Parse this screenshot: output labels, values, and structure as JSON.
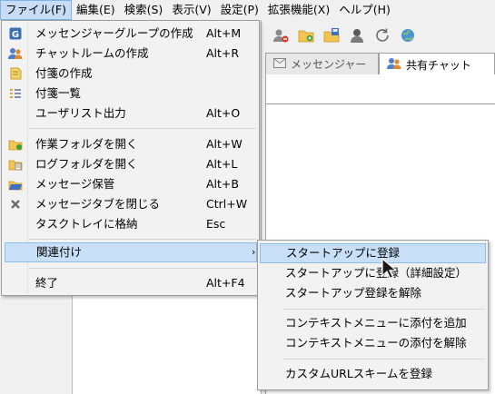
{
  "menubar": {
    "items": [
      {
        "label": "ファイル(F)"
      },
      {
        "label": "編集(E)"
      },
      {
        "label": "検索(S)"
      },
      {
        "label": "表示(V)"
      },
      {
        "label": "設定(P)"
      },
      {
        "label": "拡張機能(X)"
      },
      {
        "label": "ヘルプ(H)"
      }
    ]
  },
  "file_menu": {
    "items": [
      {
        "label": "メッセンジャーグループの作成",
        "shortcut": "Alt+M",
        "icon": "group-icon"
      },
      {
        "label": "チャットルームの作成",
        "shortcut": "Alt+R",
        "icon": "chatroom-icon"
      },
      {
        "label": "付箋の作成",
        "shortcut": "",
        "icon": "sticky-note-icon"
      },
      {
        "label": "付箋一覧",
        "shortcut": "",
        "icon": "sticky-list-icon"
      },
      {
        "label": "ユーザリスト出力",
        "shortcut": "Alt+O",
        "icon": ""
      },
      {
        "label": "作業フォルダを開く",
        "shortcut": "Alt+W",
        "icon": "work-folder-icon"
      },
      {
        "label": "ログフォルダを開く",
        "shortcut": "Alt+L",
        "icon": "log-folder-icon"
      },
      {
        "label": "メッセージ保管",
        "shortcut": "Alt+B",
        "icon": "archive-folder-icon"
      },
      {
        "label": "メッセージタブを閉じる",
        "shortcut": "Ctrl+W",
        "icon": "close-x-icon"
      },
      {
        "label": "タスクトレイに格納",
        "shortcut": "Esc",
        "icon": ""
      },
      {
        "label": "関連付け",
        "shortcut": "",
        "icon": ""
      },
      {
        "label": "終了",
        "shortcut": "Alt+F4",
        "icon": ""
      }
    ],
    "submenu_arrow": "›"
  },
  "association_submenu": {
    "items": [
      {
        "label": "スタートアップに登録"
      },
      {
        "label": "スタートアップに登録（詳細設定）"
      },
      {
        "label": "スタートアップ登録を解除"
      },
      {
        "label": "コンテキストメニューに添付を追加"
      },
      {
        "label": "コンテキストメニューの添付を解除"
      },
      {
        "label": "カスタムURLスキームを登録"
      }
    ]
  },
  "tabs": [
    {
      "label": "メッセンジャー",
      "icon": "envelope-icon",
      "active": false
    },
    {
      "label": "共有チャット",
      "icon": "people-icon",
      "active": true
    }
  ],
  "colors": {
    "highlight": "#c8e0f7",
    "highlight_border": "#8dbbeb",
    "menu_bg": "#f2f2f2"
  }
}
